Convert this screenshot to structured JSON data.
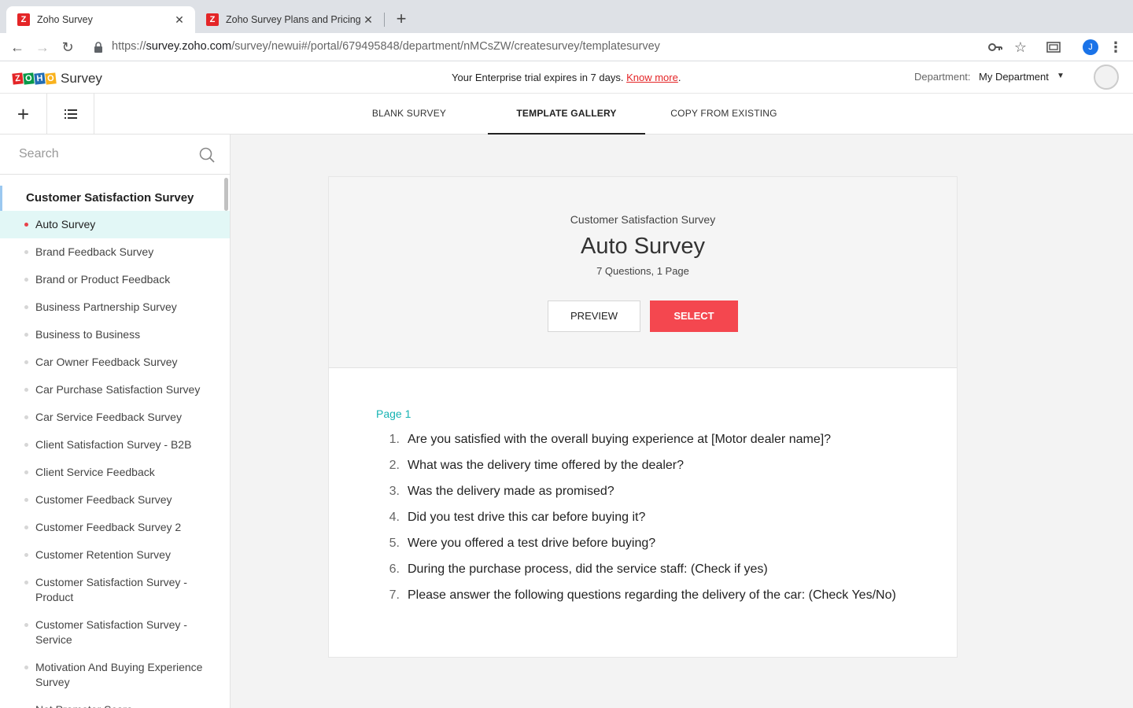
{
  "browser": {
    "tabs": [
      {
        "title": "Zoho Survey",
        "favicon": "Z",
        "active": true
      },
      {
        "title": "Zoho Survey Plans and Pricing",
        "favicon": "Z",
        "active": false
      }
    ],
    "url_prefix": "https://",
    "url_host": "survey.zoho.com",
    "url_path": "/survey/newui#/portal/679495848/department/nMCsZW/createsurvey/templatesurvey",
    "profile_initial": "J"
  },
  "header": {
    "product_name": "Survey",
    "logo_letters": [
      "Z",
      "O",
      "H",
      "O"
    ],
    "logo_colors": [
      "#e42527",
      "#089949",
      "#226db4",
      "#f9b21d"
    ],
    "trial_text": "Your Enterprise trial expires in 7 days.",
    "trial_link": "Know more",
    "trial_period": ".",
    "department_label": "Department:",
    "department_value": "My Department"
  },
  "subnav": {
    "tabs": [
      {
        "label": "BLANK SURVEY",
        "active": false
      },
      {
        "label": "TEMPLATE GALLERY",
        "active": true
      },
      {
        "label": "COPY FROM EXISTING",
        "active": false
      }
    ]
  },
  "sidebar": {
    "search_placeholder": "Search",
    "category": "Customer Satisfaction Survey",
    "items": [
      {
        "label": "Auto Survey",
        "active": true
      },
      {
        "label": "Brand Feedback Survey"
      },
      {
        "label": "Brand or Product Feedback"
      },
      {
        "label": "Business Partnership Survey"
      },
      {
        "label": "Business to Business"
      },
      {
        "label": "Car Owner Feedback Survey"
      },
      {
        "label": "Car Purchase Satisfaction Survey"
      },
      {
        "label": "Car Service Feedback Survey"
      },
      {
        "label": "Client Satisfaction Survey - B2B"
      },
      {
        "label": "Client Service Feedback"
      },
      {
        "label": "Customer Feedback Survey"
      },
      {
        "label": "Customer Feedback Survey 2"
      },
      {
        "label": "Customer Retention Survey"
      },
      {
        "label": "Customer Satisfaction Survey - Product"
      },
      {
        "label": "Customer Satisfaction Survey - Service"
      },
      {
        "label": "Motivation And Buying Experience Survey"
      },
      {
        "label": "Net Promoter Score"
      }
    ]
  },
  "template": {
    "category": "Customer Satisfaction Survey",
    "title": "Auto Survey",
    "meta": "7 Questions, 1 Page",
    "preview_label": "PREVIEW",
    "select_label": "SELECT",
    "page_label": "Page 1",
    "questions": [
      {
        "num": "1.",
        "text": "Are you satisfied with the overall buying experience at [Motor dealer name]?"
      },
      {
        "num": "2.",
        "text": "What was the delivery time offered by the dealer?"
      },
      {
        "num": "3.",
        "text": "Was the delivery made as promised?"
      },
      {
        "num": "4.",
        "text": "Did you test drive this car before buying it?"
      },
      {
        "num": "5.",
        "text": "Were you offered a test drive before buying?"
      },
      {
        "num": "6.",
        "text": "During the purchase process, did the service staff: (Check if yes)"
      },
      {
        "num": "7.",
        "text": "Please answer the following questions regarding the delivery of the car: (Check Yes/No)"
      }
    ]
  },
  "colors": {
    "accent_red": "#f4474f",
    "page_label": "#17b3b3",
    "active_item_bg": "#e2f7f6"
  }
}
